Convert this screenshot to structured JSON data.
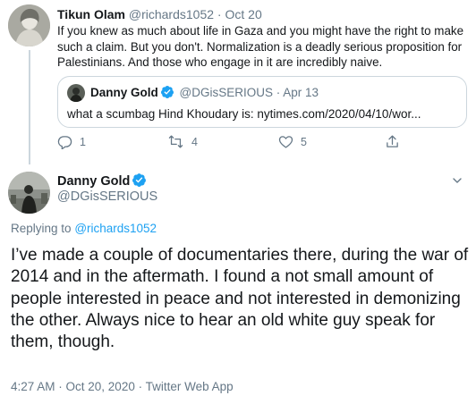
{
  "colors": {
    "accent": "#1da1f2",
    "muted": "#657786",
    "border": "#ccd6dd",
    "text": "#14171a"
  },
  "first_tweet": {
    "author_name": "Tikun Olam",
    "author_handle": "@richards1052",
    "separator": "·",
    "date": "Oct 20",
    "text": "If you knew as much about life in Gaza and you might have the right to make such a claim. But you don't. Normalization is a deadly serious proposition for Palestinians. And those who engage in it are incredibly naive.",
    "quoted": {
      "author_name": "Danny Gold",
      "author_handle": "@DGisSERIOUS",
      "separator": "·",
      "date": "Apr 13",
      "verified_icon": "verified-badge-icon",
      "text": "what a scumbag Hind Khoudary is: nytimes.com/2020/04/10/wor..."
    },
    "actions": {
      "reply_count": "1",
      "retweet_count": "4",
      "like_count": "5",
      "icons": [
        "reply-icon",
        "retweet-icon",
        "like-icon",
        "share-icon"
      ]
    }
  },
  "main_tweet": {
    "author_name": "Danny Gold",
    "author_handle": "@DGisSERIOUS",
    "verified_icon": "verified-badge-icon",
    "more_icon": "chevron-down-icon",
    "replying_prefix": "Replying to",
    "replying_to": "@richards1052",
    "text": "I’ve made a couple of documentaries there, during the war of 2014 and in the aftermath. I found a not small amount of people interested in peace and not interested in demonizing the other. Always nice to hear an old white guy speak for them, though.",
    "meta": "4:27 AM · Oct 20, 2020 · Twitter Web App"
  }
}
